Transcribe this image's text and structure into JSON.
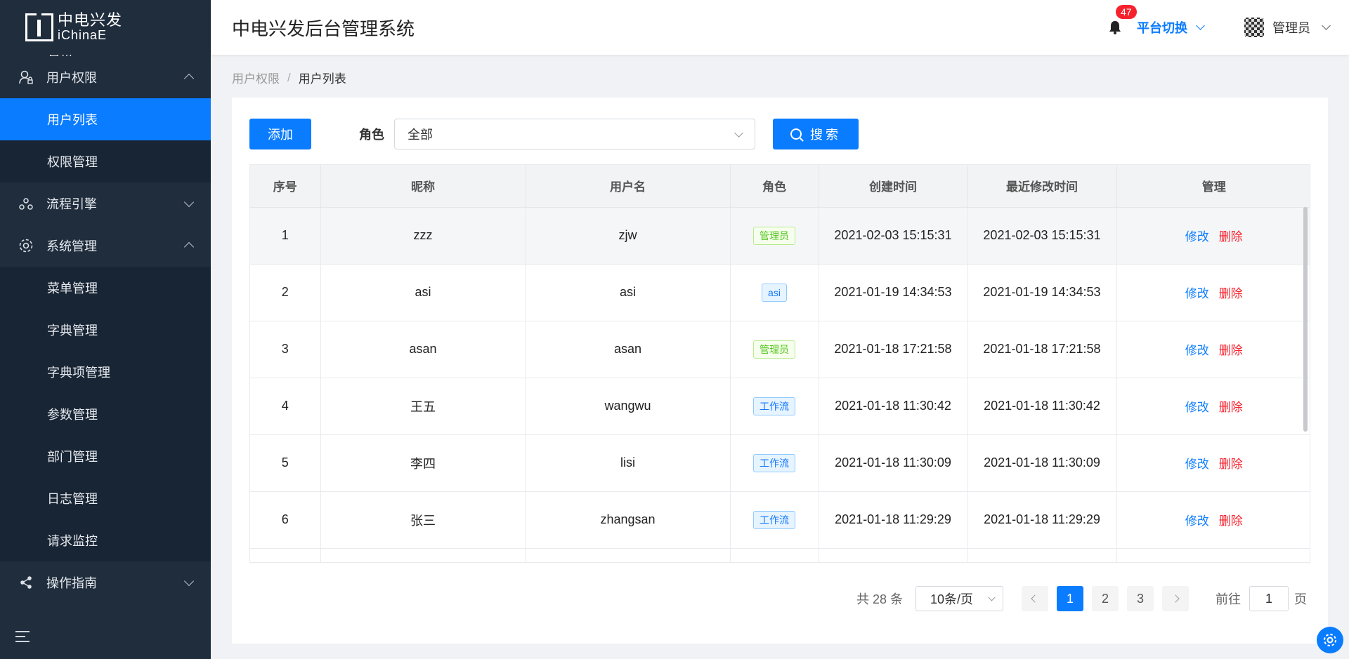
{
  "logo": {
    "cn": "中电兴发",
    "en": "iChinaE"
  },
  "header": {
    "title": "中电兴发后台管理系统",
    "notification_count": "47",
    "platform_switch": "平台切换",
    "user_name": "管理员"
  },
  "sidebar": {
    "partial_item": "首页",
    "groups": [
      {
        "label": "用户权限",
        "expanded": true,
        "icon": "user-lock-icon",
        "items": [
          {
            "label": "用户列表",
            "active": true
          },
          {
            "label": "权限管理"
          }
        ]
      },
      {
        "label": "流程引擎",
        "expanded": false,
        "icon": "flow-icon"
      },
      {
        "label": "系统管理",
        "expanded": true,
        "icon": "gear-icon",
        "items": [
          {
            "label": "菜单管理"
          },
          {
            "label": "字典管理"
          },
          {
            "label": "字典项管理"
          },
          {
            "label": "参数管理"
          },
          {
            "label": "部门管理"
          },
          {
            "label": "日志管理"
          },
          {
            "label": "请求监控"
          }
        ]
      },
      {
        "label": "操作指南",
        "expanded": false,
        "icon": "share-icon"
      }
    ]
  },
  "breadcrumb": {
    "parent": "用户权限",
    "separator": "/",
    "current": "用户列表"
  },
  "toolbar": {
    "add_label": "添加",
    "role_label": "角色",
    "role_value": "全部",
    "search_label": "搜索"
  },
  "table": {
    "columns": [
      "序号",
      "昵称",
      "用户名",
      "角色",
      "创建时间",
      "最近修改时间",
      "管理"
    ],
    "rows": [
      {
        "no": "1",
        "nickname": "zzz",
        "username": "zjw",
        "role": "管理员",
        "role_color": "green",
        "created": "2021-02-03 15:15:31",
        "modified": "2021-02-03 15:15:31"
      },
      {
        "no": "2",
        "nickname": "asi",
        "username": "asi",
        "role": "asi",
        "role_color": "blue",
        "created": "2021-01-19 14:34:53",
        "modified": "2021-01-19 14:34:53"
      },
      {
        "no": "3",
        "nickname": "asan",
        "username": "asan",
        "role": "管理员",
        "role_color": "green",
        "created": "2021-01-18 17:21:58",
        "modified": "2021-01-18 17:21:58"
      },
      {
        "no": "4",
        "nickname": "王五",
        "username": "wangwu",
        "role": "工作流",
        "role_color": "blue",
        "created": "2021-01-18 11:30:42",
        "modified": "2021-01-18 11:30:42"
      },
      {
        "no": "5",
        "nickname": "李四",
        "username": "lisi",
        "role": "工作流",
        "role_color": "blue",
        "created": "2021-01-18 11:30:09",
        "modified": "2021-01-18 11:30:09"
      },
      {
        "no": "6",
        "nickname": "张三",
        "username": "zhangsan",
        "role": "工作流",
        "role_color": "blue",
        "created": "2021-01-18 11:29:29",
        "modified": "2021-01-18 11:29:29"
      }
    ],
    "edit_label": "修改",
    "delete_label": "删除"
  },
  "pagination": {
    "total": "共 28 条",
    "page_size": "10条/页",
    "pages": [
      "1",
      "2",
      "3"
    ],
    "current_page": "1",
    "goto_prefix": "前往",
    "goto_value": "1",
    "goto_suffix": "页"
  },
  "colors": {
    "primary": "#0a7cff",
    "sidebar_bg": "#1f2d3d",
    "danger": "#f5222d",
    "tag_green": "#52c41a"
  }
}
